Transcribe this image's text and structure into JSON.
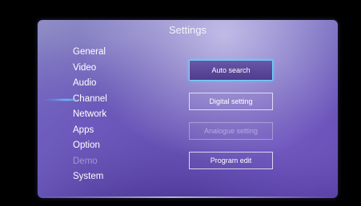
{
  "title": "Settings",
  "menu": [
    {
      "label": "General",
      "state": "normal"
    },
    {
      "label": "Video",
      "state": "normal"
    },
    {
      "label": "Audio",
      "state": "normal"
    },
    {
      "label": "Channel",
      "state": "active"
    },
    {
      "label": "Network",
      "state": "normal"
    },
    {
      "label": "Apps",
      "state": "normal"
    },
    {
      "label": "Option",
      "state": "normal"
    },
    {
      "label": "Demo",
      "state": "disabled"
    },
    {
      "label": "System",
      "state": "normal"
    }
  ],
  "buttons": {
    "auto_search": "Auto search",
    "digital_setting": "Digital setting",
    "analogue_setting": "Analogue setting",
    "program_edit": "Program edit"
  },
  "colors": {
    "focus_border": "#6fd4ff",
    "panel_purple": "#6e63bb"
  }
}
